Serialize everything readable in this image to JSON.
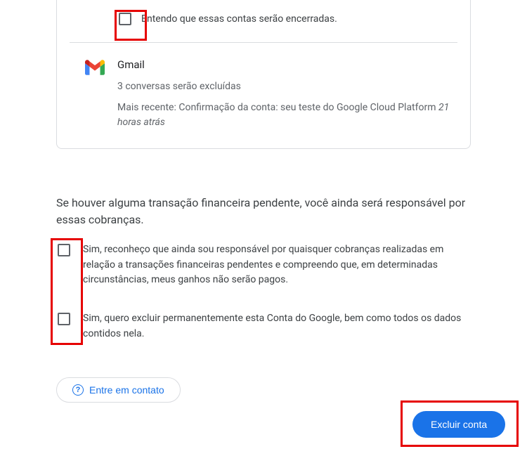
{
  "card": {
    "understand_label": "Entendo que essas contas serão encerradas."
  },
  "gmail": {
    "title": "Gmail",
    "sub": "3 conversas serão excluídas",
    "recent_prefix": "Mais recente: ",
    "recent_subject": "Confirmação da conta: seu teste do Google Cloud Platform",
    "recent_time": "21 horas atrás"
  },
  "pending_text": "Se houver alguma transação financeira pendente, você ainda será responsável por essas cobranças.",
  "ack1_text": "Sim, reconheço que ainda sou responsável por quaisquer cobranças realizadas em relação a transações financeiras pendentes e compreendo que, em determinadas circunstâncias, meus ganhos não serão pagos.",
  "ack2_text": "Sim, quero excluir permanentemente esta Conta do Google, bem como todos os dados contidos nela.",
  "contact_label": "Entre em contato",
  "delete_label": "Excluir conta"
}
